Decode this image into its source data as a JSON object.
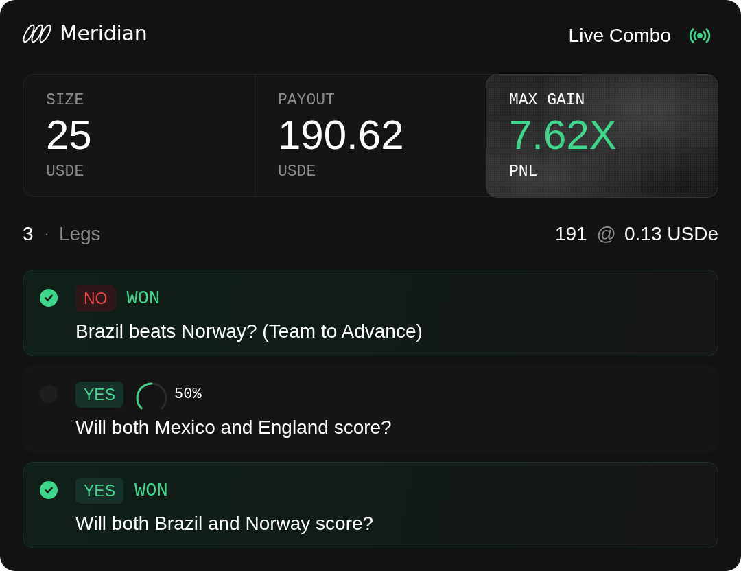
{
  "header": {
    "brand": "Meridian",
    "mode": "Live Combo"
  },
  "stats": [
    {
      "label": "SIZE",
      "value": "25",
      "unit": "USDE",
      "highlighted": false
    },
    {
      "label": "PAYOUT",
      "value": "190.62",
      "unit": "USDE",
      "highlighted": false
    },
    {
      "label": "MAX GAIN",
      "value": "7.62X",
      "unit": "PNL",
      "highlighted": true
    }
  ],
  "summary": {
    "count": "3",
    "separator": "·",
    "label": "Legs",
    "quantity": "191",
    "at": "@",
    "price": "0.13 USDe"
  },
  "legs": [
    {
      "kind": "won",
      "checked": true,
      "pick": {
        "label": "NO",
        "kind": "no"
      },
      "result": "WON",
      "question": "Brazil beats Norway? (Team to Advance)"
    },
    {
      "kind": "pending",
      "checked": false,
      "pick": {
        "label": "YES",
        "kind": "yes"
      },
      "level": 0.5,
      "reading": "50%",
      "question": "Will both Mexico and England score?"
    },
    {
      "kind": "won",
      "checked": true,
      "pick": {
        "label": "YES",
        "kind": "yes"
      },
      "result": "WON",
      "question": "Will both Brazil and Norway score?"
    }
  ]
}
